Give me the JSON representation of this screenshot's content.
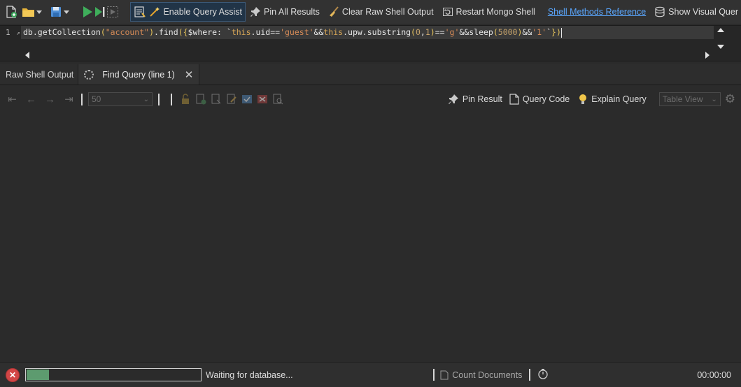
{
  "toolbar": {
    "enable_query_assist": "Enable Query Assist",
    "pin_all_results": "Pin All Results",
    "clear_raw_shell_output": "Clear Raw Shell Output",
    "restart_mongo_shell": "Restart Mongo Shell",
    "shell_methods_reference": "Shell Methods Reference",
    "show_visual_query": "Show Visual Quer"
  },
  "editor": {
    "line_number": "1",
    "tokens": {
      "db": "db",
      "dot1": ".",
      "getCollection": "getCollection",
      "lp1": "(",
      "collection": "\"account\"",
      "rp1": ")",
      "dot2": ".",
      "find": "find",
      "lp2": "(",
      "lb": "{",
      "where": "$where: `",
      "this1": "this",
      "uid": ".uid==",
      "guest": "'guest'",
      "and1": "&&",
      "this2": "this",
      "upw": ".upw.substring",
      "lp3": "(",
      "n0": "0",
      "comma": ",",
      "n1": "1",
      "rp3": ")",
      "eq": "==",
      "g": "'g'",
      "and2": "&&sleep",
      "lp4": "(",
      "n5000": "5000",
      "rp4": ")",
      "and3": "&&",
      "one": "'1'",
      "bt": "`",
      "rb": "}",
      "rp2": ")"
    }
  },
  "tabs": [
    {
      "label": "Raw Shell Output"
    },
    {
      "label": "Find Query (line 1)"
    }
  ],
  "results_toolbar": {
    "page_size": "50",
    "pin_result": "Pin Result",
    "query_code": "Query Code",
    "explain_query": "Explain Query",
    "view_mode": "Table View"
  },
  "status": {
    "progress": 0.13,
    "message": "Waiting for database...",
    "count_documents": "Count Documents",
    "elapsed": "00:00:00"
  },
  "colors": {
    "accent_link": "#5aa7ff",
    "progress_fill": "#5d9b6f",
    "stop_red": "#d24646",
    "play_green": "#3fae5b"
  }
}
